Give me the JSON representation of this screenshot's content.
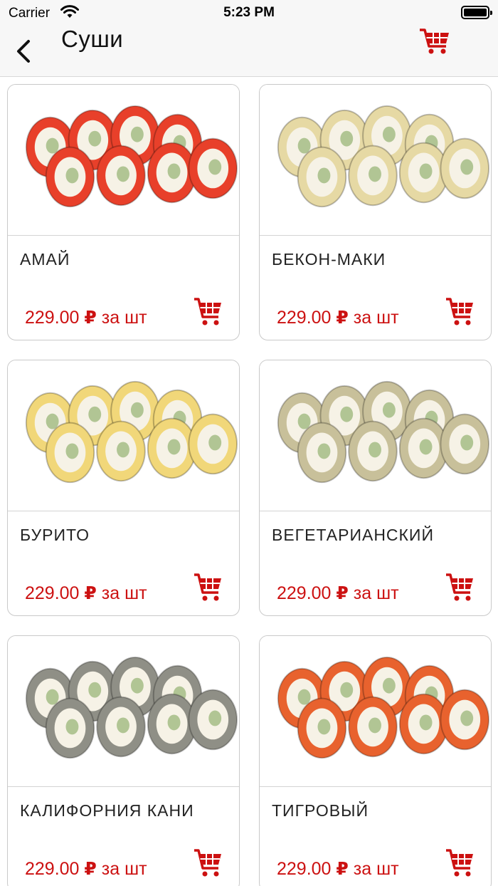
{
  "status_bar": {
    "carrier": "Carrier",
    "time": "5:23 PM"
  },
  "nav": {
    "title": "Суши",
    "back_icon": "chevron-left-icon",
    "cart_icon": "cart-icon"
  },
  "colors": {
    "accent": "#cc1111",
    "nav_background": "#f7f7f7",
    "card_border": "#c9c9c9"
  },
  "products": [
    {
      "name": "АМАЙ",
      "price": "229.00",
      "currency": "₽",
      "unit": "за шт",
      "roll_color": "#e8402a"
    },
    {
      "name": "БЕКОН-МАКИ",
      "price": "229.00",
      "currency": "₽",
      "unit": "за шт",
      "roll_color": "#e6d9a4"
    },
    {
      "name": "БУРИТО",
      "price": "229.00",
      "currency": "₽",
      "unit": "за шт",
      "roll_color": "#f1d779"
    },
    {
      "name": "ВЕГЕТАРИАНСКИЙ",
      "price": "229.00",
      "currency": "₽",
      "unit": "за шт",
      "roll_color": "#c8c09a"
    },
    {
      "name": "КАЛИФОРНИЯ КАНИ",
      "price": "229.00",
      "currency": "₽",
      "unit": "за шт",
      "roll_color": "#8f8f86"
    },
    {
      "name": "ТИГРОВЫЙ",
      "price": "229.00",
      "currency": "₽",
      "unit": "за шт",
      "roll_color": "#e8622e"
    }
  ]
}
